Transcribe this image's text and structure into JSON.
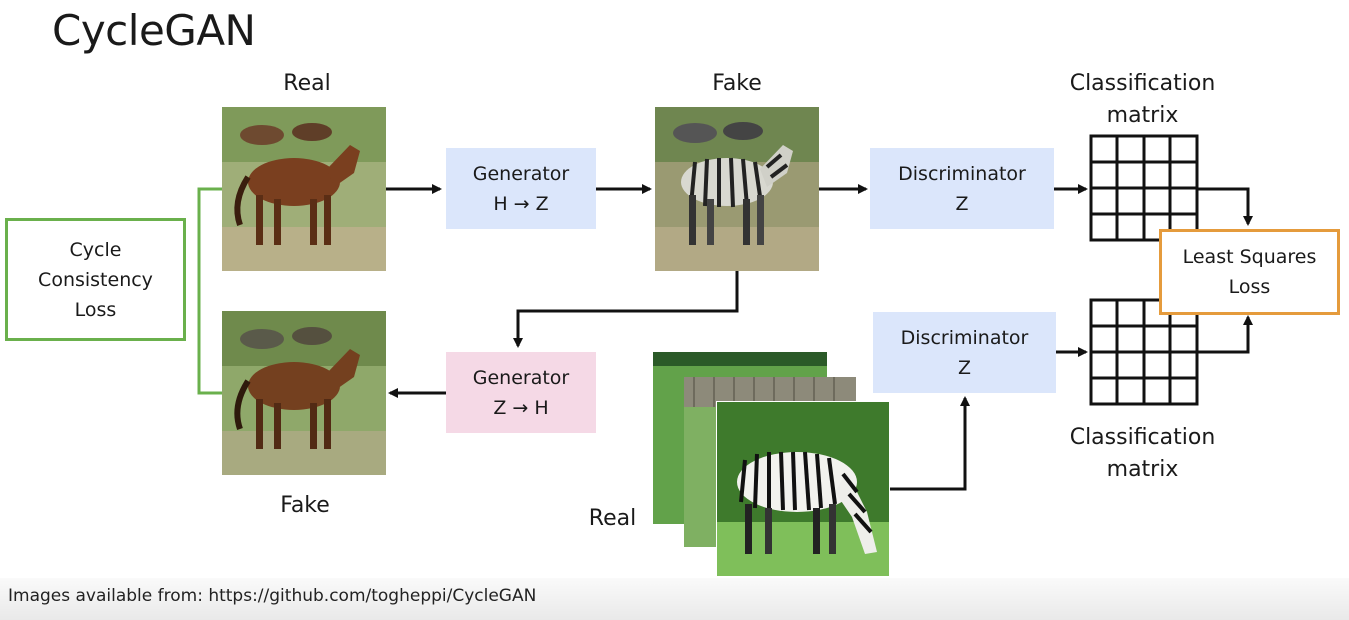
{
  "title": "CycleGAN",
  "labels": {
    "real_top": "Real",
    "fake_top": "Fake",
    "fake_bottom": "Fake",
    "real_bottom": "Real",
    "class_top_1": "Classification",
    "class_top_2": "matrix",
    "class_bottom_1": "Classification",
    "class_bottom_2": "matrix"
  },
  "boxes": {
    "gen_hz_1": "Generator",
    "gen_hz_2": "H → Z",
    "gen_zh_1": "Generator",
    "gen_zh_2": "Z → H",
    "disc_top_1": "Discriminator",
    "disc_top_2": "Z",
    "disc_bottom_1": "Discriminator",
    "disc_bottom_2": "Z",
    "cycle_1": "Cycle",
    "cycle_2": "Consistency",
    "cycle_3": "Loss",
    "lsq_1": "Least Squares",
    "lsq_2": "Loss"
  },
  "footer": "Images available from: https://github.com/togheppi/CycleGAN",
  "colors": {
    "generator_forward": "#dbe6fb",
    "generator_backward": "#f5d9e6",
    "discriminator": "#dbe6fb",
    "cycle_border": "#6ab04c",
    "loss_border": "#e59b3c"
  }
}
